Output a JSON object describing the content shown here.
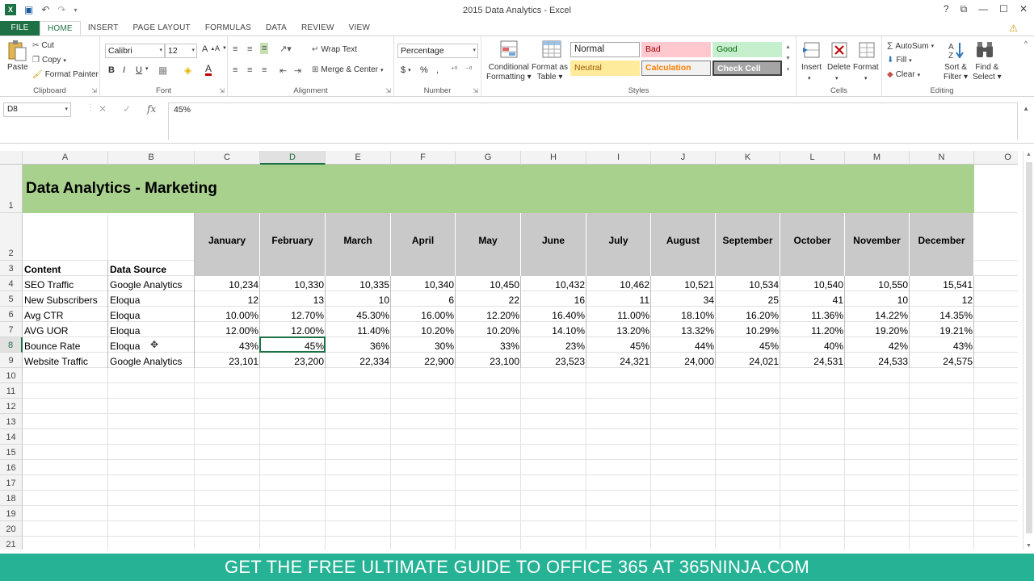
{
  "window": {
    "title": "2015 Data Analytics - Excel",
    "controls": [
      "?",
      "⧉",
      "—",
      "☐",
      "✕"
    ]
  },
  "tabs": [
    {
      "label": "FILE"
    },
    {
      "label": "HOME"
    },
    {
      "label": "INSERT"
    },
    {
      "label": "PAGE LAYOUT"
    },
    {
      "label": "FORMULAS"
    },
    {
      "label": "DATA"
    },
    {
      "label": "REVIEW"
    },
    {
      "label": "VIEW"
    }
  ],
  "ribbon": {
    "clipboard": {
      "label": "Clipboard",
      "paste": "Paste",
      "cut": "Cut",
      "copy": "Copy",
      "format_painter": "Format Painter"
    },
    "font": {
      "label": "Font",
      "name": "Calibri",
      "size": "12",
      "bold": "B",
      "italic": "I",
      "underline": "U"
    },
    "alignment": {
      "label": "Alignment",
      "wrap_text": "Wrap Text",
      "merge_center": "Merge & Center"
    },
    "number": {
      "label": "Number",
      "format": "Percentage",
      "currency": "$",
      "percent": "%",
      "comma": ","
    },
    "styles": {
      "label": "Styles",
      "conditional": [
        "Conditional",
        "Formatting"
      ],
      "format_table": [
        "Format as",
        "Table"
      ],
      "cells": [
        {
          "name": "Normal"
        },
        {
          "name": "Bad"
        },
        {
          "name": "Good"
        },
        {
          "name": "Neutral"
        },
        {
          "name": "Calculation"
        },
        {
          "name": "Check Cell"
        }
      ]
    },
    "cells": {
      "label": "Cells",
      "insert": "Insert",
      "delete": "Delete",
      "format": "Format"
    },
    "editing": {
      "label": "Editing",
      "autosum": "AutoSum",
      "fill": "Fill",
      "clear": "Clear",
      "sort": [
        "Sort &",
        "Filter"
      ],
      "find": [
        "Find &",
        "Select"
      ]
    }
  },
  "formula_bar": {
    "name_box": "D8",
    "formula": "45%",
    "fx": "fx"
  },
  "columns": [
    "A",
    "B",
    "C",
    "D",
    "E",
    "F",
    "G",
    "H",
    "I",
    "J",
    "K",
    "L",
    "M",
    "N",
    "O"
  ],
  "rows": [
    "1",
    "2",
    "3",
    "4",
    "5",
    "6",
    "7",
    "8",
    "9",
    "10",
    "11",
    "12",
    "13",
    "14",
    "15",
    "16",
    "17",
    "18",
    "19",
    "20",
    "21"
  ],
  "sheet": {
    "title": "Data Analytics - Marketing",
    "content_header": "Content",
    "source_header": "Data Source",
    "months": [
      "January",
      "February",
      "March",
      "April",
      "May",
      "June",
      "July",
      "August",
      "September",
      "October",
      "November",
      "December"
    ],
    "data": [
      {
        "content": "SEO Traffic",
        "source": "Google Analytics",
        "values": [
          "10,234",
          "10,330",
          "10,335",
          "10,340",
          "10,450",
          "10,432",
          "10,462",
          "10,521",
          "10,534",
          "10,540",
          "10,550",
          "15,541"
        ]
      },
      {
        "content": "New Subscribers",
        "source": "Eloqua",
        "values": [
          "12",
          "13",
          "10",
          "6",
          "22",
          "16",
          "11",
          "34",
          "25",
          "41",
          "10",
          "12"
        ]
      },
      {
        "content": "Avg CTR",
        "source": "Eloqua",
        "values": [
          "10.00%",
          "12.70%",
          "45.30%",
          "16.00%",
          "12.20%",
          "16.40%",
          "11.00%",
          "18.10%",
          "16.20%",
          "11.36%",
          "14.22%",
          "14.35%"
        ]
      },
      {
        "content": "AVG UOR",
        "source": "Eloqua",
        "values": [
          "12.00%",
          "12.00%",
          "11.40%",
          "10.20%",
          "10.20%",
          "14.10%",
          "13.20%",
          "13.32%",
          "10.29%",
          "11.20%",
          "19.20%",
          "19.21%"
        ]
      },
      {
        "content": "Bounce Rate",
        "source": "Eloqua",
        "values": [
          "43%",
          "45%",
          "36%",
          "30%",
          "33%",
          "23%",
          "45%",
          "44%",
          "45%",
          "40%",
          "42%",
          "43%"
        ]
      },
      {
        "content": "Website Traffic",
        "source": "Google Analytics",
        "values": [
          "23,101",
          "23,200",
          "22,334",
          "22,900",
          "23,100",
          "23,523",
          "24,321",
          "24,000",
          "24,021",
          "24,531",
          "24,533",
          "24,575"
        ]
      }
    ]
  },
  "colors": {
    "excel_green": "#1e7145",
    "title_band": "#a9d18e",
    "month_header": "#c9c9c9",
    "banner": "#26b295"
  },
  "banner": "GET THE FREE ULTIMATE GUIDE TO OFFICE 365 AT 365NINJA.COM"
}
